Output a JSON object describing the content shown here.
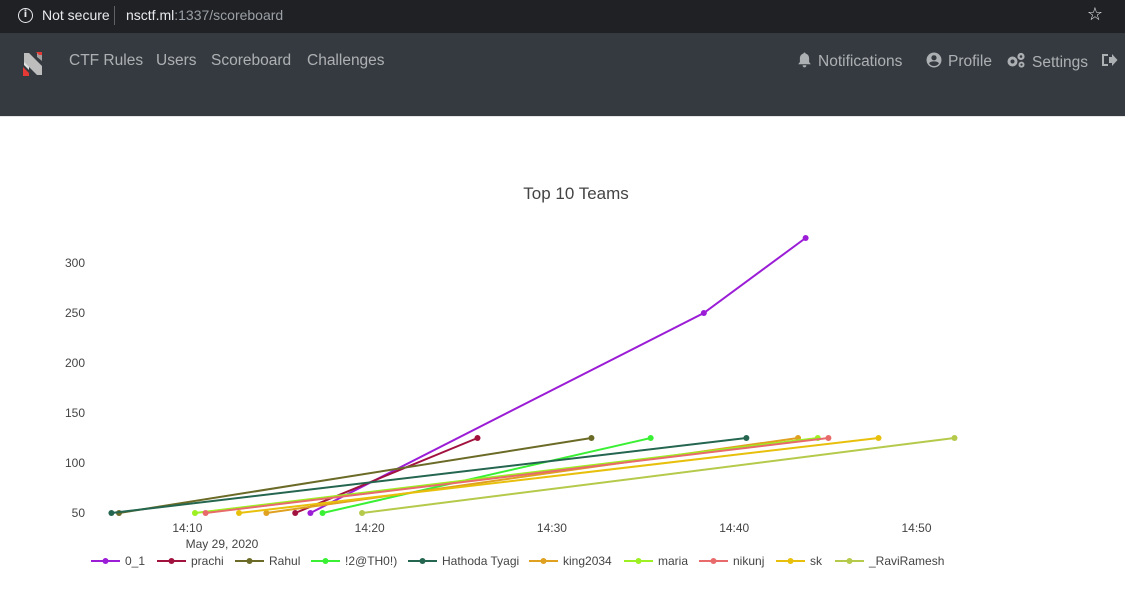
{
  "browser": {
    "security_label": "Not secure",
    "url_host": "nsctf.ml",
    "url_path": ":1337/scoreboard"
  },
  "navbar": {
    "left_links": [
      "CTF Rules",
      "Users",
      "Scoreboard",
      "Challenges"
    ],
    "right_links": [
      "Notifications",
      "Profile",
      "Settings"
    ]
  },
  "chart_data": {
    "type": "line",
    "title": "Top 10 Teams",
    "x_ticks": [
      "14:10",
      "14:20",
      "14:30",
      "14:40",
      "14:50"
    ],
    "x_date_label": "May 29, 2020",
    "y_ticks": [
      50,
      100,
      150,
      200,
      250,
      300
    ],
    "x_range": [
      "2020-05-29 14:04:00",
      "2020-05-29 14:56:30"
    ],
    "y_range": [
      35,
      325
    ],
    "legend_position": "bottom",
    "series": [
      {
        "name": "0_1",
        "color": "#9b1dd6",
        "points": [
          [
            "14:16:45",
            50
          ],
          [
            "14:38:20",
            250
          ],
          [
            "14:43:55",
            325
          ]
        ]
      },
      {
        "name": "prachi",
        "color": "#a1123f",
        "points": [
          [
            "14:15:55",
            50
          ],
          [
            "14:25:55",
            125
          ]
        ]
      },
      {
        "name": "Rahul",
        "color": "#6b6b27",
        "points": [
          [
            "14:06:15",
            50
          ],
          [
            "14:32:10",
            125
          ]
        ]
      },
      {
        "name": "!2@TH0!)",
        "color": "#3af034",
        "points": [
          [
            "14:17:25",
            50
          ],
          [
            "14:35:25",
            125
          ]
        ]
      },
      {
        "name": "Hathoda Tyagi",
        "color": "#24664f",
        "points": [
          [
            "14:05:50",
            50
          ],
          [
            "14:40:40",
            125
          ]
        ]
      },
      {
        "name": "king2034",
        "color": "#e0a020",
        "points": [
          [
            "14:14:20",
            50
          ],
          [
            "14:43:30",
            125
          ]
        ]
      },
      {
        "name": "maria",
        "color": "#9df021",
        "points": [
          [
            "14:10:25",
            50
          ],
          [
            "14:44:35",
            125
          ]
        ]
      },
      {
        "name": "nikunj",
        "color": "#e86a6a",
        "points": [
          [
            "14:11:00",
            50
          ],
          [
            "14:45:10",
            125
          ]
        ]
      },
      {
        "name": "sk",
        "color": "#e8c00c",
        "points": [
          [
            "14:12:50",
            50
          ],
          [
            "14:47:55",
            125
          ]
        ]
      },
      {
        "name": "_RaviRamesh",
        "color": "#b5c94a",
        "points": [
          [
            "14:19:35",
            50
          ],
          [
            "14:52:05",
            125
          ]
        ]
      }
    ]
  }
}
